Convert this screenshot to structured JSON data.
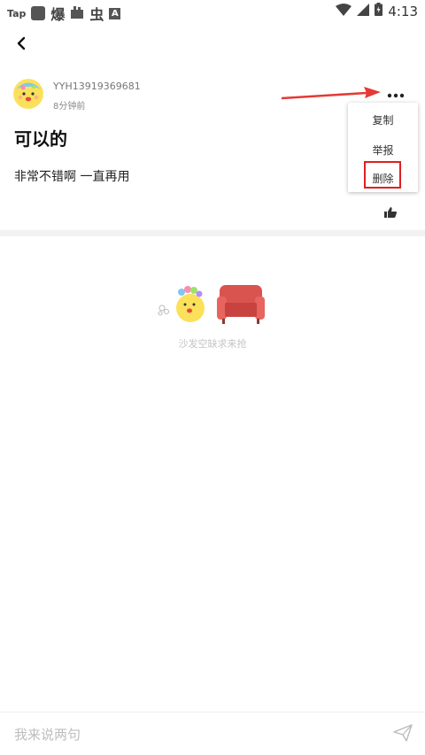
{
  "status_bar": {
    "tap": "Tap",
    "glyph_1": "爆",
    "glyph_2": "虫",
    "letter": "A",
    "time": "4:13"
  },
  "post": {
    "username": "YYH13919369681",
    "time_ago": "8分钟前",
    "title": "可以的",
    "body": "非常不错啊  一直再用"
  },
  "menu": {
    "copy": "复制",
    "report": "举报",
    "delete": "删除"
  },
  "comments": {
    "empty_text": "沙发空缺求来抢"
  },
  "composer": {
    "placeholder": "我来说两句"
  },
  "colors": {
    "highlight": "#e02020",
    "arrow": "#e53935"
  }
}
